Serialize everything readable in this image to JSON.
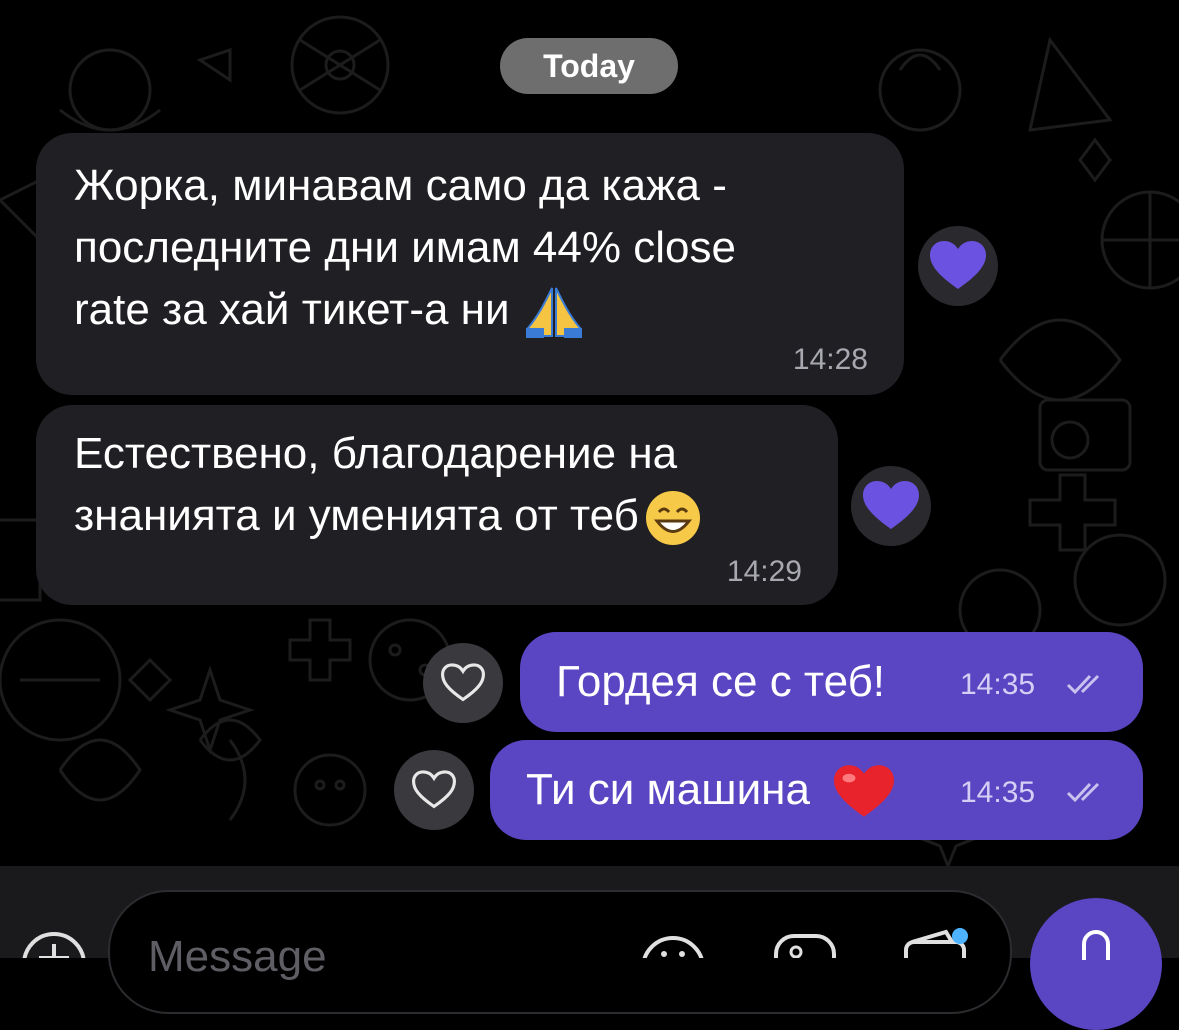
{
  "chat": {
    "date_label": "Today",
    "messages": [
      {
        "direction": "incoming",
        "lines": [
          "Жорка, минавам само да кажа -",
          "последните дни имам 44% close",
          "rate за хай тикет-а ни"
        ],
        "emoji": "folded-hands",
        "time": "14:28",
        "reaction": "purple-heart"
      },
      {
        "direction": "incoming",
        "lines": [
          "Естествено, благодарение на",
          "знанията и уменията от теб"
        ],
        "emoji": "grinning-face",
        "time": "14:29",
        "reaction": "purple-heart"
      },
      {
        "direction": "outgoing",
        "text": "Гордея се с теб!",
        "time": "14:35",
        "status": "read-double-check",
        "reaction": "empty-heart"
      },
      {
        "direction": "outgoing",
        "text": "Ти си машина",
        "emoji": "red-heart",
        "time": "14:35",
        "status": "read-double-check",
        "reaction": "empty-heart"
      }
    ]
  },
  "composer": {
    "placeholder": "Message",
    "icons": [
      "plus-icon",
      "emoji-icon",
      "sticker-icon",
      "wallet-icon",
      "microphone-icon"
    ]
  },
  "colors": {
    "background": "#000000",
    "incoming_bubble": "#1f1f24",
    "outgoing_bubble": "#5a45c2",
    "reaction_heart": "#6b52e0",
    "date_pill": "#6e6e6e",
    "accent_dot": "#4db2ff"
  }
}
